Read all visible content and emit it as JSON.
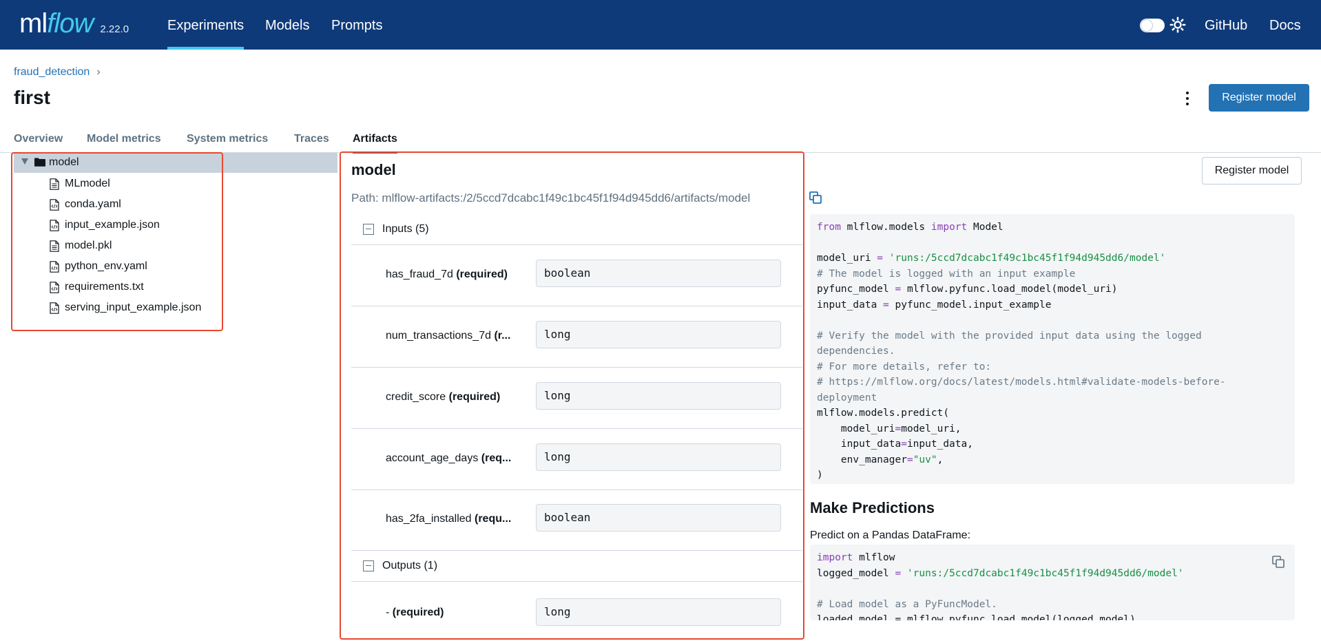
{
  "nav": {
    "logo_ml": "ml",
    "logo_flow": "flow",
    "version": "2.22.0",
    "items": [
      "Experiments",
      "Models",
      "Prompts"
    ],
    "active": "Experiments",
    "github": "GitHub",
    "docs": "Docs"
  },
  "breadcrumb": {
    "experiment": "fraud_detection",
    "separator": "›"
  },
  "page": {
    "title": "first",
    "register_label": "Register model"
  },
  "tabs": [
    "Overview",
    "Model metrics",
    "System metrics",
    "Traces",
    "Artifacts"
  ],
  "active_tab": "Artifacts",
  "tree": {
    "root": "model",
    "files": [
      "MLmodel",
      "conda.yaml",
      "input_example.json",
      "model.pkl",
      "python_env.yaml",
      "requirements.txt",
      "serving_input_example.json"
    ]
  },
  "schema": {
    "title": "model",
    "path": "Path: mlflow-artifacts:/2/5ccd7dcabc1f49c1bc45f1f94d945dd6/artifacts/model",
    "inputs_label": "Inputs (5)",
    "outputs_label": "Outputs (1)",
    "inputs": [
      {
        "name": "has_fraud_7d",
        "req": "(required)",
        "type": "boolean"
      },
      {
        "name": "num_transactions_7d",
        "req": "(r...",
        "type": "long"
      },
      {
        "name": "credit_score",
        "req": "(required)",
        "type": "long"
      },
      {
        "name": "account_age_days",
        "req": "(req...",
        "type": "long"
      },
      {
        "name": "has_2fa_installed",
        "req": "(requ...",
        "type": "boolean"
      }
    ],
    "outputs": [
      {
        "name": "-",
        "req": "(required)",
        "type": "long"
      }
    ]
  },
  "right": {
    "register_label": "Register model",
    "code1": {
      "from": "from",
      "module": " mlflow.models ",
      "import": "import",
      "cls": " Model",
      "uri_var": "model_uri",
      "eq": " = ",
      "uri_str": "'runs:/5ccd7dcabc1f49c1bc45f1f94d945dd6/model'",
      "c1": "# The model is logged with an input example",
      "l4a": "pyfunc_model",
      "l4b": " mlflow.pyfunc.load_model(model_uri)",
      "l5a": "input_data",
      "l5b": " pyfunc_model.input_example",
      "c2": "# Verify the model with the provided input data using the logged",
      "c2b": "dependencies.",
      "c3": "# For more details, refer to:",
      "c4": "# https://mlflow.org/docs/latest/models.html#validate-models-before-",
      "c4b": "deployment",
      "p1": "mlflow.models.predict(",
      "p2a": "    model_uri",
      "p2b": "model_uri,",
      "p3a": "    input_data",
      "p3b": "input_data,",
      "p4a": "    env_manager",
      "p4b": "\"uv\"",
      "p4c": ",",
      "p5": ")"
    },
    "predictions_title": "Make Predictions",
    "predictions_desc": "Predict on a Pandas DataFrame:",
    "code2": {
      "import": "import",
      "module": " mlflow",
      "var": "logged_model",
      "eq": " = ",
      "str": "'runs:/5ccd7dcabc1f49c1bc45f1f94d945dd6/model'",
      "c1": "# Load model as a PyFuncModel.",
      "l5": "loaded_model = mlflow.pyfunc.load_model(logged_model)"
    }
  },
  "colors": {
    "nav_bg": "#0e3a7a",
    "accent": "#43c9ed",
    "primary": "#2272b4",
    "highlight_border": "#e8482e"
  }
}
